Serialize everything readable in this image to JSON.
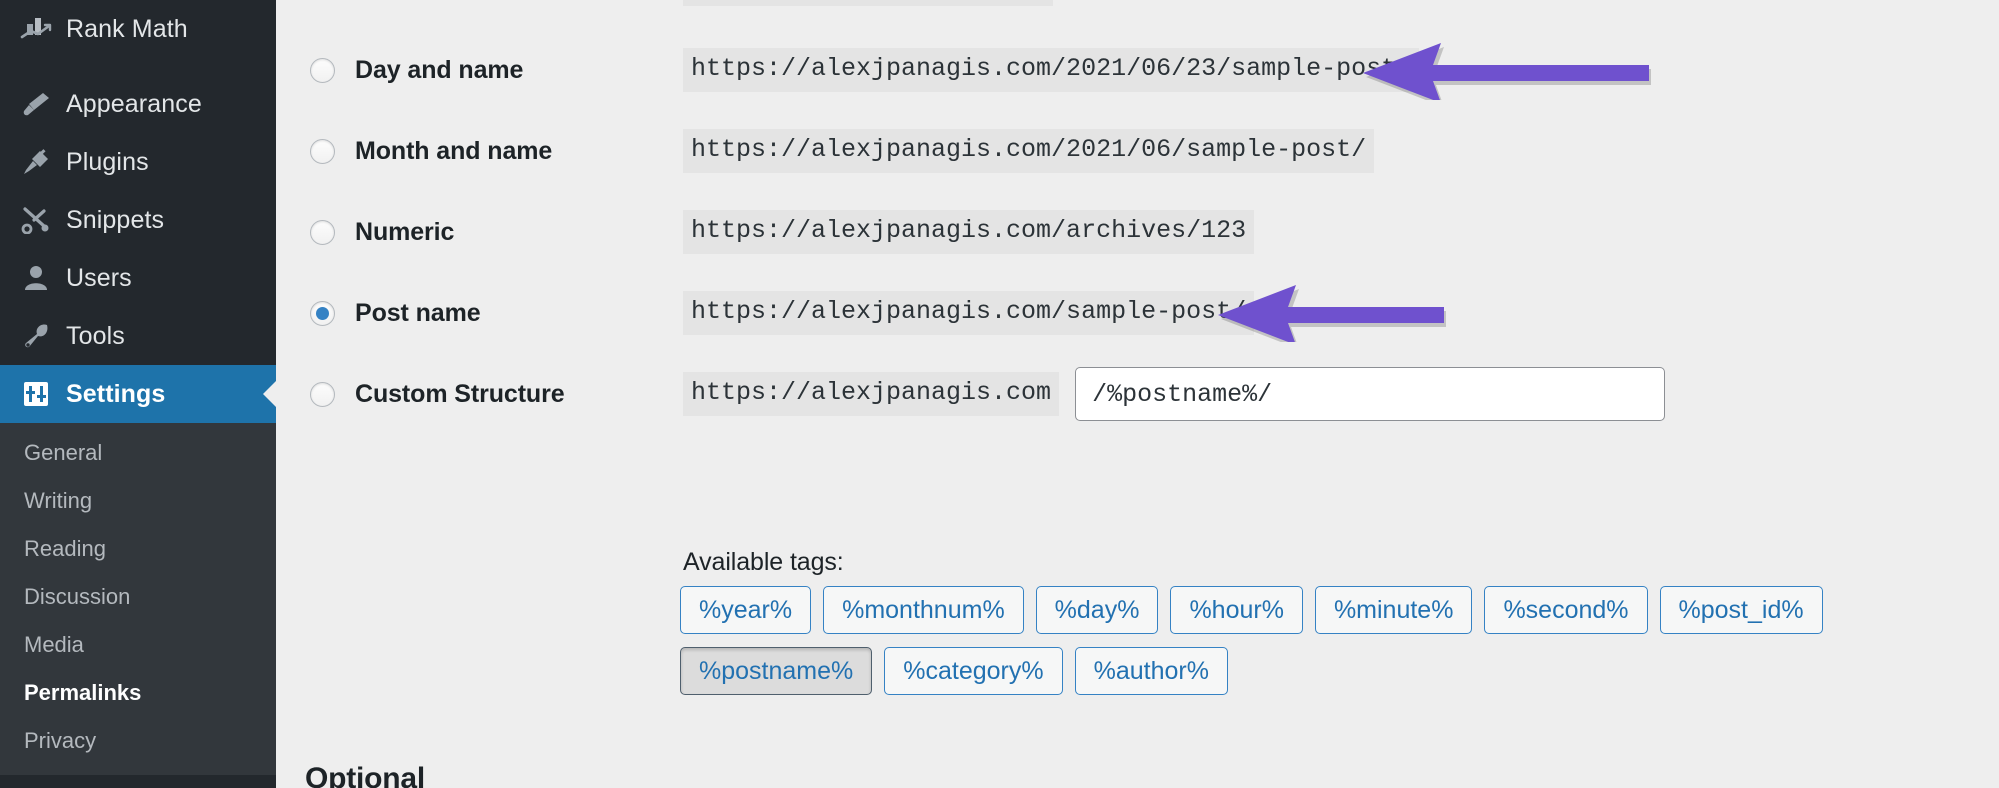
{
  "sidebar": {
    "items": [
      {
        "label": "Rank Math",
        "icon": "rank-math-icon",
        "state": "normal"
      },
      {
        "label": "Appearance",
        "icon": "paintbrush-icon",
        "state": "normal"
      },
      {
        "label": "Plugins",
        "icon": "plug-icon",
        "state": "normal"
      },
      {
        "label": "Snippets",
        "icon": "scissors-icon",
        "state": "normal"
      },
      {
        "label": "Users",
        "icon": "user-icon",
        "state": "normal"
      },
      {
        "label": "Tools",
        "icon": "wrench-icon",
        "state": "normal"
      },
      {
        "label": "Settings",
        "icon": "settings-sliders-icon",
        "state": "current"
      }
    ],
    "submenu": [
      {
        "label": "General",
        "active": false
      },
      {
        "label": "Writing",
        "active": false
      },
      {
        "label": "Reading",
        "active": false
      },
      {
        "label": "Discussion",
        "active": false
      },
      {
        "label": "Media",
        "active": false
      },
      {
        "label": "Permalinks",
        "active": true
      },
      {
        "label": "Privacy",
        "active": false
      }
    ]
  },
  "permalinks": {
    "options": [
      {
        "label": "Day and name",
        "url": "https://alexjpanagis.com/2021/06/23/sample-post/",
        "selected": false
      },
      {
        "label": "Month and name",
        "url": "https://alexjpanagis.com/2021/06/sample-post/",
        "selected": false
      },
      {
        "label": "Numeric",
        "url": "https://alexjpanagis.com/archives/123",
        "selected": false
      },
      {
        "label": "Post name",
        "url": "https://alexjpanagis.com/sample-post/",
        "selected": true
      }
    ],
    "custom": {
      "label": "Custom Structure",
      "selected": false,
      "base_url": "https://alexjpanagis.com",
      "value": "/%postname%/",
      "placeholder": ""
    },
    "available_tags_label": "Available tags:",
    "tags": [
      {
        "label": "%year%",
        "pressed": false
      },
      {
        "label": "%monthnum%",
        "pressed": false
      },
      {
        "label": "%day%",
        "pressed": false
      },
      {
        "label": "%hour%",
        "pressed": false
      },
      {
        "label": "%minute%",
        "pressed": false
      },
      {
        "label": "%second%",
        "pressed": false
      },
      {
        "label": "%post_id%",
        "pressed": false
      },
      {
        "label": "%postname%",
        "pressed": true
      },
      {
        "label": "%category%",
        "pressed": false
      },
      {
        "label": "%author%",
        "pressed": false
      }
    ],
    "optional_heading": "Optional"
  },
  "annotations": {
    "arrows": [
      {
        "name": "arrow-day-and-name",
        "direction": "left",
        "color": "#6f51ce"
      },
      {
        "name": "arrow-post-name",
        "direction": "left",
        "color": "#6f51ce"
      }
    ]
  },
  "colors": {
    "sidebar_bg": "#23282d",
    "submenu_bg": "#32373c",
    "current_menu_bg": "#1e73aa",
    "accent_blue": "#2271b1",
    "radio_selected": "#3582c4",
    "arrow_purple": "#6f51ce",
    "content_bg": "#eeeeee",
    "code_bg": "#e4e4e4"
  }
}
